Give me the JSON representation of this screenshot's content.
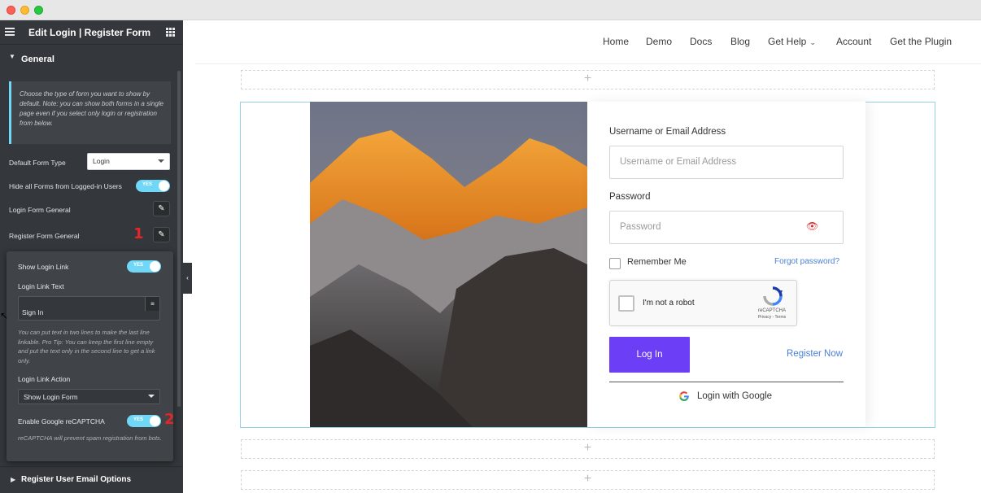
{
  "window": {
    "traffic_lights": [
      "close",
      "minimize",
      "zoom"
    ]
  },
  "panel": {
    "title": "Edit Login | Register Form",
    "section": "General",
    "notice": "Choose the type of form you want to show by default. Note: you can show both forms in a single page even if you select only login or registration from below.",
    "default_form_type_label": "Default Form Type",
    "default_form_type_value": "Login",
    "hide_forms_label": "Hide all Forms from Logged-in Users",
    "hide_forms_toggle": "YES",
    "login_form_general": "Login Form General",
    "register_form_general": "Register Form General",
    "marker_1": "1",
    "marker_2": "2",
    "popover": {
      "show_login_link_label": "Show Login Link",
      "show_login_link_toggle": "YES",
      "login_link_text_label": "Login Link Text",
      "login_link_text_value": "Sign In",
      "login_link_help": "You can put text in two lines to make the last line linkable. Pro Tip: You can keep the first line empty and put the text only in the second line to get a link only.",
      "login_link_action_label": "Login Link Action",
      "login_link_action_value": "Show Login Form",
      "recaptcha_label": "Enable Google reCAPTCHA",
      "recaptcha_toggle": "YES",
      "recaptcha_help": "reCAPTCHA will prevent spam registration from bots."
    },
    "footer_section": "Register User Email Options"
  },
  "nav": {
    "items": [
      "Home",
      "Demo",
      "Docs",
      "Blog",
      "Get Help",
      "Account",
      "Get the Plugin"
    ]
  },
  "form": {
    "username_label": "Username or Email Address",
    "username_placeholder": "Username or Email Address",
    "password_label": "Password",
    "password_placeholder": "Password",
    "remember_me": "Remember Me",
    "forgot_password": "Forgot password?",
    "captcha_text": "I'm not a robot",
    "captcha_brand": "reCAPTCHA",
    "captcha_links": "Privacy - Terms",
    "login_button": "Log In",
    "register_now": "Register Now",
    "google_login": "Login with Google"
  },
  "colors": {
    "panel_bg": "#34383c",
    "accent_toggle": "#71d7f7",
    "login_button": "#6c3ff6",
    "link": "#4a7fd6",
    "marker": "#e3262a"
  }
}
